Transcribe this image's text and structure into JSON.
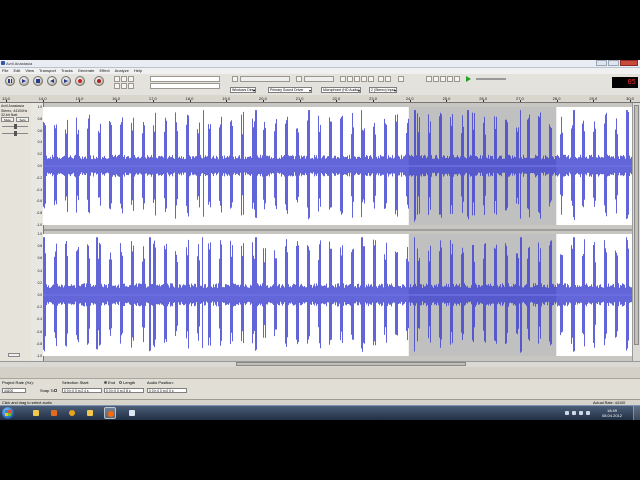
{
  "window": {
    "title": "Avril Anastasia",
    "minimize": "_",
    "maximize": "□",
    "close": "×"
  },
  "menu": [
    "File",
    "Edit",
    "View",
    "Transport",
    "Tracks",
    "Generate",
    "Effect",
    "Analyze",
    "Help"
  ],
  "toolbar": {
    "devices": {
      "host": "Windows DirectSound",
      "output": "Primary Sound Driver",
      "input": "Microphone (HD Audio)",
      "channels": "2 (Stereo) Input"
    },
    "clock_value": "05"
  },
  "ruler": {
    "ticks": [
      "13,0",
      "14,0",
      "15,0",
      "16,0",
      "17,0",
      "18,0",
      "19,0",
      "20,0",
      "21,0",
      "22,0",
      "23,0",
      "24,0",
      "25,0",
      "26,0",
      "27,0",
      "28,0",
      "29,0",
      "30,0"
    ]
  },
  "track": {
    "name": "Avril Anastasia",
    "info1": "Stereo, 44100Hz",
    "info2": "32-bit float",
    "mute": "Mute",
    "solo": "Solo",
    "scale_labels": [
      "1.0",
      "0.8",
      "0.6",
      "0.4",
      "0.2",
      "0.0",
      "-0.2",
      "-0.4",
      "-0.6",
      "-0.8",
      "-1.0"
    ],
    "selection_fraction": {
      "start": 0.62,
      "end": 0.87
    }
  },
  "selection_bar": {
    "project_rate_label": "Project Rate (Hz):",
    "project_rate_value": "44100",
    "snap_to_label": "Snap To",
    "selection_start_label": "Selection Start:",
    "end_label": "End",
    "length_label": "Length",
    "audio_position_label": "Audio Position:",
    "selection_start_value": "0 0 h 0 0 m 2 4 s",
    "selection_end_value": "0 0 h 0 0 m 2 8 s",
    "audio_position_value": "0 0 h 0 0 m 0 0 s"
  },
  "status": {
    "left": "Click and drag to select audio",
    "right": "Actual Rate: 44100"
  },
  "taskbar": {
    "time": "18:49",
    "date": "08.04.2012",
    "colors": {
      "chrome": "#e8a31c",
      "explorer": "#f2c94c",
      "media": "#e36b1f",
      "audacity": "#ff6a00",
      "doc": "#dde6f3"
    }
  },
  "colors": {
    "waveform": "#3a3fcf",
    "waveform_rms": "#6f74e6",
    "track_bg": "#ffffff",
    "selection_bg": "#c0c0c0"
  }
}
